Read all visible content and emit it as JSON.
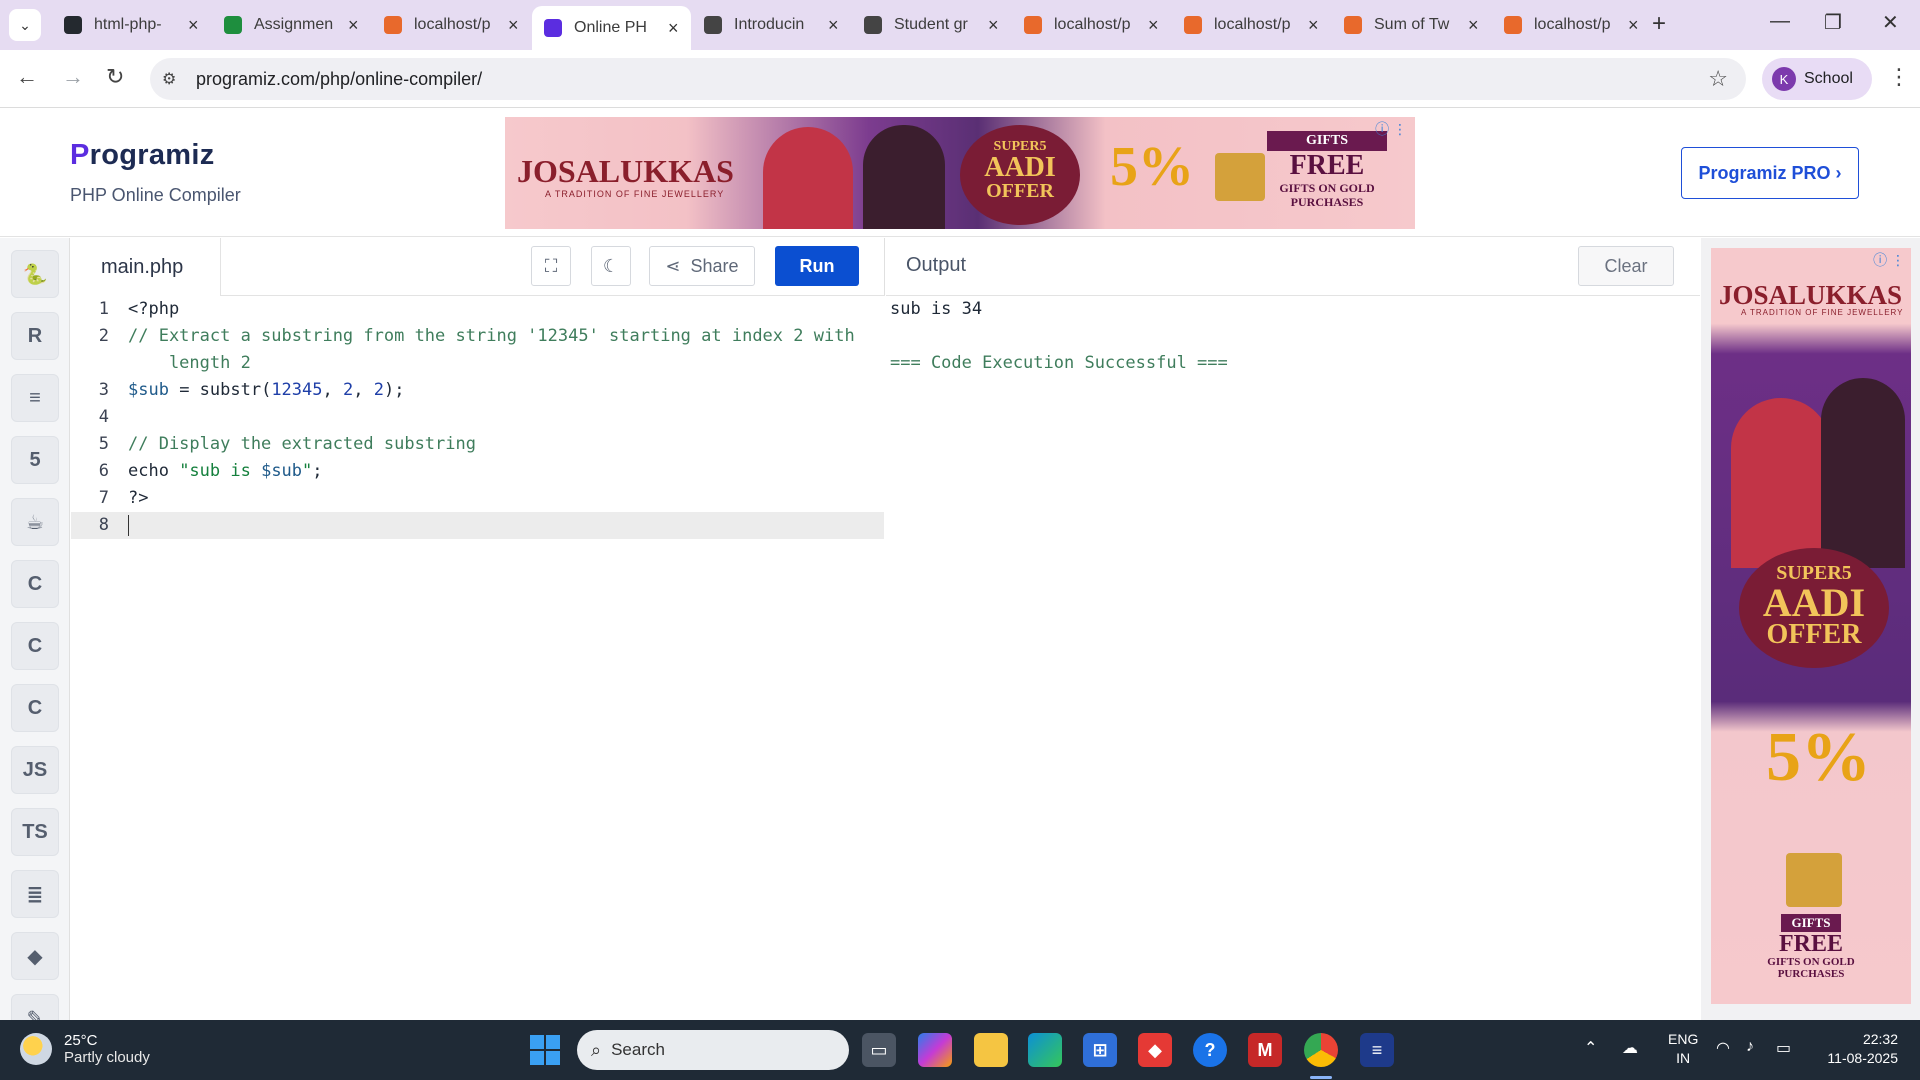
{
  "browser": {
    "tabs": [
      {
        "label": "html-php-",
        "favicon": "github-icon",
        "color": "#24292f"
      },
      {
        "label": "Assignmen",
        "favicon": "classroom-icon",
        "color": "#1e8e3e"
      },
      {
        "label": "localhost/p",
        "favicon": "xampp-icon",
        "color": "#e8692c"
      },
      {
        "label": "Online PH",
        "favicon": "programiz-icon",
        "color": "#5b2de0"
      },
      {
        "label": "Introducin",
        "favicon": "openai-icon",
        "color": "#444444"
      },
      {
        "label": "Student gr",
        "favicon": "chatgpt-icon",
        "color": "#444444"
      },
      {
        "label": "localhost/p",
        "favicon": "xampp-icon",
        "color": "#e8692c"
      },
      {
        "label": "localhost/p",
        "favicon": "xampp-icon",
        "color": "#e8692c"
      },
      {
        "label": "Sum of Tw",
        "favicon": "xampp-icon",
        "color": "#e8692c"
      },
      {
        "label": "localhost/p",
        "favicon": "xampp-icon",
        "color": "#e8692c"
      }
    ],
    "active_tab": 3,
    "url": "programiz.com/php/online-compiler/",
    "profile_initial": "K",
    "profile_name": "School"
  },
  "header": {
    "logo": "rogramiz",
    "logo_initial": "P",
    "subtitle": "PHP Online Compiler",
    "pro_button": "Programiz PRO ›"
  },
  "ad_banner": {
    "brand": "JOSALUKKAS",
    "tagline": "A TRADITION OF FINE JEWELLERY",
    "offer_top": "SUPER5",
    "offer_main": "AADI",
    "offer_sub": "OFFER",
    "percent": "5%",
    "gifts_label": "GIFTS",
    "free": "FREE",
    "gifts_line": "GIFTS ON GOLD PURCHASES"
  },
  "sidebar": {
    "languages": [
      {
        "name": "python-icon",
        "glyph": "🐍"
      },
      {
        "name": "r-icon",
        "glyph": "R"
      },
      {
        "name": "sql-icon",
        "glyph": "≡"
      },
      {
        "name": "html-icon",
        "glyph": "5"
      },
      {
        "name": "java-icon",
        "glyph": "☕"
      },
      {
        "name": "c-icon",
        "glyph": "C"
      },
      {
        "name": "cplusplus-icon",
        "glyph": "C"
      },
      {
        "name": "csharp-icon",
        "glyph": "C"
      },
      {
        "name": "javascript-icon",
        "glyph": "JS"
      },
      {
        "name": "typescript-icon",
        "glyph": "TS"
      },
      {
        "name": "go-icon",
        "glyph": "≣"
      },
      {
        "name": "php-icon",
        "glyph": "◆"
      },
      {
        "name": "swift-icon",
        "glyph": "✎"
      }
    ]
  },
  "editor": {
    "filename": "main.php",
    "share_label": "Share",
    "run_label": "Run",
    "lines": [
      {
        "n": "1",
        "text": "<?php"
      },
      {
        "n": "2",
        "text": "// Extract a substring from the string '12345' starting at index 2 with"
      },
      {
        "n": "",
        "text": "    length 2"
      },
      {
        "n": "3",
        "text": "$sub = substr(12345, 2, 2);"
      },
      {
        "n": "4",
        "text": ""
      },
      {
        "n": "5",
        "text": "// Display the extracted substring"
      },
      {
        "n": "6",
        "text": "echo \"sub is $sub\";"
      },
      {
        "n": "7",
        "text": "?>"
      },
      {
        "n": "8",
        "text": ""
      }
    ]
  },
  "output": {
    "title": "Output",
    "clear_label": "Clear",
    "lines": [
      "sub is 34",
      "",
      "=== Code Execution Successful ==="
    ]
  },
  "taskbar": {
    "temperature": "25°C",
    "weather": "Partly cloudy",
    "search_placeholder": "Search",
    "language": "ENG",
    "region": "IN",
    "time": "22:32",
    "date": "11-08-2025"
  }
}
